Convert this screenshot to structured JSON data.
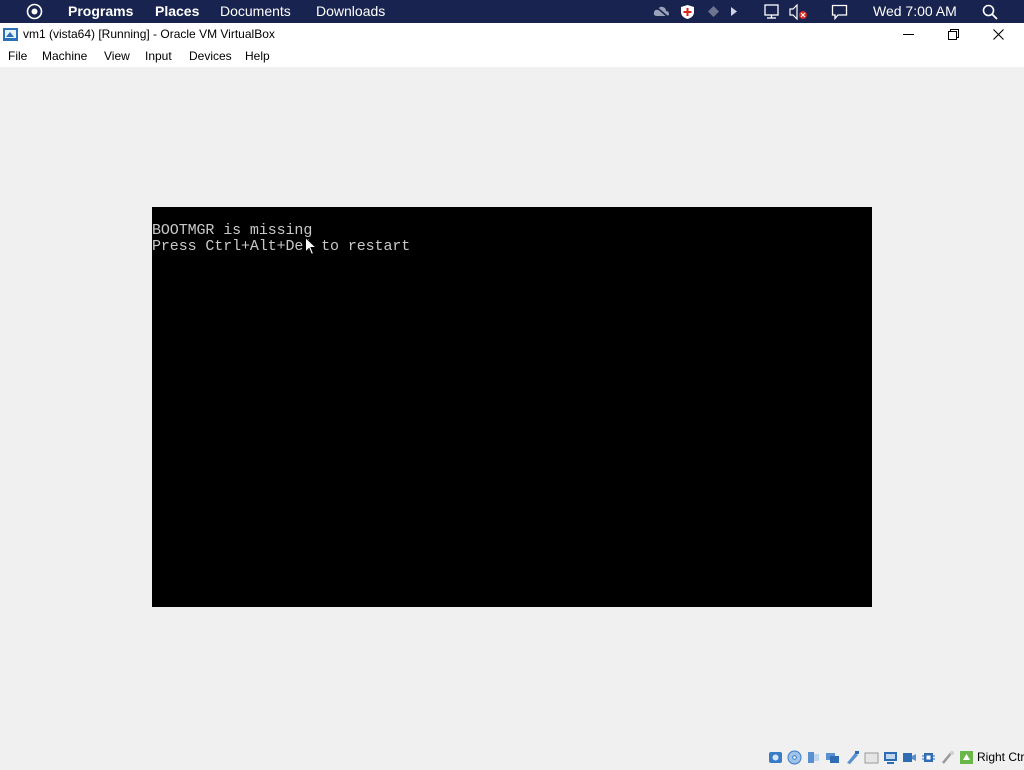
{
  "top_panel": {
    "menus": [
      "Programs",
      "Places",
      "Documents",
      "Downloads"
    ],
    "clock": "Wed 7:00 AM",
    "icons": [
      "activities-icon",
      "cloud-off-icon",
      "shield-icon",
      "diamond-icon",
      "play-icon",
      "network-icon",
      "volume-muted-icon",
      "chat-icon",
      "search-icon"
    ]
  },
  "window": {
    "title": "vm1 (vista64) [Running] - Oracle VM VirtualBox",
    "controls": [
      "minimize",
      "restore",
      "close"
    ]
  },
  "menubar": {
    "items": [
      "File",
      "Machine",
      "View",
      "Input",
      "Devices",
      "Help"
    ]
  },
  "vm_console": {
    "lines": [
      "BOOTMGR is missing",
      "Press Ctrl+Alt+Del to restart"
    ],
    "background": "#000000",
    "text_color": "#c8c8c8"
  },
  "statusbar": {
    "indicators": [
      "hard-disk-icon",
      "optical-drive-icon",
      "audio-icon",
      "network-adapter-icon",
      "usb-icon",
      "shared-folders-icon",
      "display-icon",
      "video-capture-icon",
      "cpu-icon",
      "mouse-integration-icon",
      "keyboard-icon"
    ],
    "host_key": "Right Ctrl"
  },
  "colors": {
    "panel_bg": "#18234f",
    "window_bg": "#f0f0f0"
  }
}
